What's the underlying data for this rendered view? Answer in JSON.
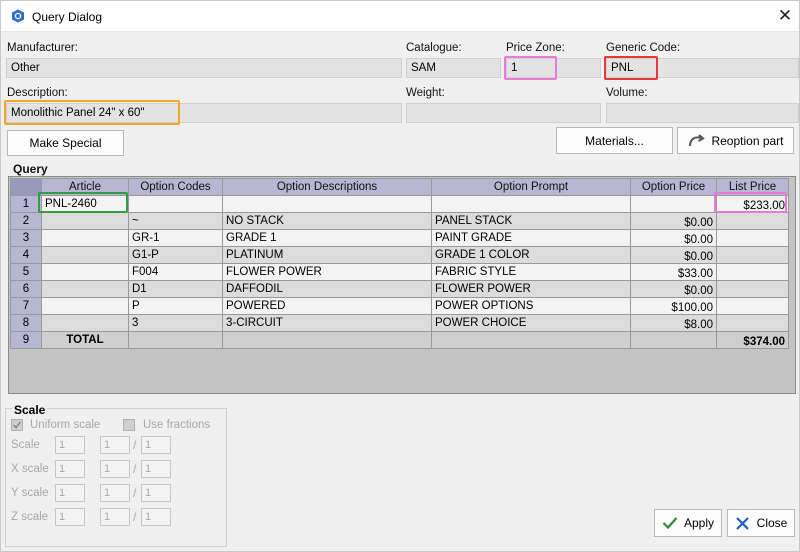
{
  "window": {
    "title": "Query Dialog",
    "close_glyph": "✕"
  },
  "fields": {
    "manufacturer": {
      "label": "Manufacturer:",
      "value": "Other"
    },
    "catalogue": {
      "label": "Catalogue:",
      "value": "SAM"
    },
    "price_zone": {
      "label": "Price Zone:",
      "value": "1"
    },
    "generic_code": {
      "label": "Generic Code:",
      "value": "PNL"
    },
    "description": {
      "label": "Description:",
      "value": "Monolithic Panel 24\" x 60\""
    },
    "weight": {
      "label": "Weight:",
      "value": ""
    },
    "volume": {
      "label": "Volume:",
      "value": ""
    }
  },
  "buttons": {
    "make_special": "Make Special",
    "materials": "Materials...",
    "reoption": "Reoption part",
    "apply": "Apply",
    "close": "Close"
  },
  "query": {
    "label": "Query",
    "columns": [
      "Article",
      "Option Codes",
      "Option Descriptions",
      "Option Prompt",
      "Option Price",
      "List Price"
    ],
    "rows": [
      {
        "n": "1",
        "article": "PNL-2460",
        "code": "",
        "desc": "",
        "prompt": "",
        "price": "",
        "list": "$233.00"
      },
      {
        "n": "2",
        "article": "",
        "code": "~",
        "desc": "NO STACK",
        "prompt": "PANEL STACK",
        "price": "$0.00",
        "list": ""
      },
      {
        "n": "3",
        "article": "",
        "code": "GR-1",
        "desc": "GRADE 1",
        "prompt": "PAINT GRADE",
        "price": "$0.00",
        "list": ""
      },
      {
        "n": "4",
        "article": "",
        "code": "G1-P",
        "desc": "PLATINUM",
        "prompt": "GRADE 1 COLOR",
        "price": "$0.00",
        "list": ""
      },
      {
        "n": "5",
        "article": "",
        "code": "F004",
        "desc": "FLOWER POWER",
        "prompt": "FABRIC STYLE",
        "price": "$33.00",
        "list": ""
      },
      {
        "n": "6",
        "article": "",
        "code": "D1",
        "desc": "DAFFODIL",
        "prompt": "FLOWER POWER",
        "price": "$0.00",
        "list": ""
      },
      {
        "n": "7",
        "article": "",
        "code": "P",
        "desc": "POWERED",
        "prompt": "POWER OPTIONS",
        "price": "$100.00",
        "list": ""
      },
      {
        "n": "8",
        "article": "",
        "code": "3",
        "desc": "3-CIRCUIT",
        "prompt": "POWER CHOICE",
        "price": "$8.00",
        "list": ""
      }
    ],
    "total": {
      "n": "9",
      "label": "TOTAL",
      "value": "$374.00"
    }
  },
  "scale": {
    "title": "Scale",
    "uniform_label": "Uniform scale",
    "uniform_checked": true,
    "fractions_label": "Use fractions",
    "fractions_checked": false,
    "rows": [
      {
        "label": "Scale",
        "value": "1",
        "num": "1",
        "den": "1"
      },
      {
        "label": "X scale",
        "value": "1",
        "num": "1",
        "den": "1"
      },
      {
        "label": "Y scale",
        "value": "1",
        "num": "1",
        "den": "1"
      },
      {
        "label": "Z scale",
        "value": "1",
        "num": "1",
        "den": "1"
      }
    ],
    "slash": "/"
  },
  "colors": {
    "highlight_price_zone": "#e879d8",
    "highlight_generic_code": "#e53935",
    "highlight_description": "#f5a623",
    "highlight_article": "#2ea043",
    "highlight_list_price": "#e879d8",
    "grid_header": "#b7b7d3",
    "apply_check": "#2e8b3a",
    "close_x": "#1e5fbf"
  },
  "icons": [
    "app-icon",
    "close-icon",
    "reoption-icon",
    "check-icon",
    "x-icon",
    "checkbox-checked-icon"
  ]
}
